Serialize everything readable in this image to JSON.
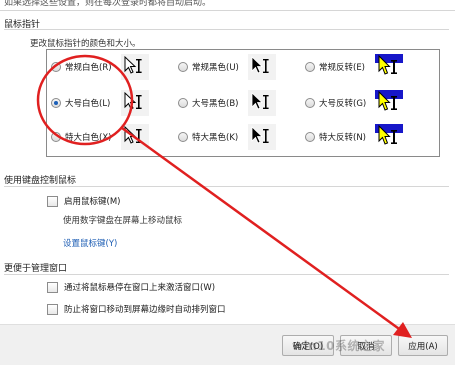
{
  "top_cut_text": "如果选择这些设置，则在每次登录时都将自动启动。",
  "pointer_section": {
    "title": "鼠标指针",
    "description": "更改鼠标指针的颜色和大小。",
    "schemes": [
      {
        "label": "常规白色(R)",
        "checked": false,
        "style": "white"
      },
      {
        "label": "常规黑色(U)",
        "checked": false,
        "style": "black"
      },
      {
        "label": "常规反转(E)",
        "checked": false,
        "style": "inverted"
      },
      {
        "label": "大号白色(L)",
        "checked": true,
        "style": "white"
      },
      {
        "label": "大号黑色(B)",
        "checked": false,
        "style": "black"
      },
      {
        "label": "大号反转(G)",
        "checked": false,
        "style": "inverted"
      },
      {
        "label": "特大白色(X)",
        "checked": false,
        "style": "white"
      },
      {
        "label": "特大黑色(K)",
        "checked": false,
        "style": "black"
      },
      {
        "label": "特大反转(N)",
        "checked": false,
        "style": "inverted"
      }
    ]
  },
  "keyboard_section": {
    "title": "使用键盘控制鼠标",
    "enable_mouse_keys": "启用鼠标键(M)",
    "mouse_keys_desc": "使用数字键盘在屏幕上移动鼠标",
    "setup_link": "设置鼠标键(Y)"
  },
  "window_section": {
    "title": "更便于管理窗口",
    "hover_activate": "通过将鼠标悬停在窗口上来激活窗口(W)",
    "prevent_arrange": "防止将窗口移动到屏幕边缘时自动排列窗口"
  },
  "buttons": {
    "ok": "确定(O)",
    "cancel": "取消",
    "apply": "应用(A)"
  },
  "watermark": "win10系统之家",
  "colors": {
    "annotation_red": "#e02020",
    "link_blue": "#1e5eb4"
  }
}
